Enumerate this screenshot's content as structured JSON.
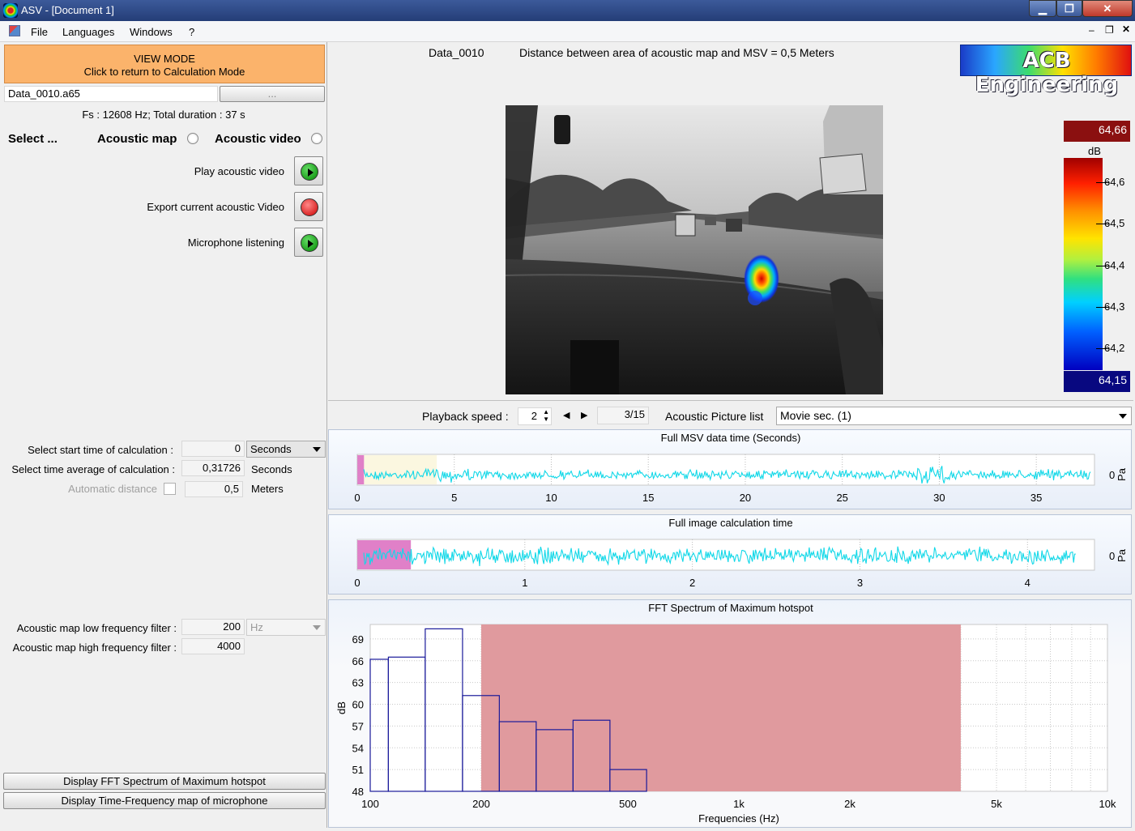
{
  "window": {
    "title": "ASV - [Document 1]"
  },
  "menu": [
    "File",
    "Languages",
    "Windows",
    "?"
  ],
  "mode_button": {
    "line1": "VIEW MODE",
    "line2": "Click to return to Calculation Mode"
  },
  "file": {
    "name": "Data_0010.a65",
    "browse": "...",
    "info": "Fs : 12608 Hz;  Total duration : 37 s"
  },
  "select": {
    "label": "Select ...",
    "option1": "Acoustic map",
    "option2": "Acoustic video"
  },
  "actions": [
    {
      "label": "Play acoustic video",
      "icon": "play-green-icon"
    },
    {
      "label": "Export current acoustic Video",
      "icon": "record-red-icon"
    },
    {
      "label": "Microphone listening",
      "icon": "play-green-icon"
    }
  ],
  "calc": {
    "start_label": "Select start time of calculation :",
    "start_value": "0",
    "start_unit": "Seconds",
    "avg_label": "Select time average of calculation :",
    "avg_value": "0,31726",
    "avg_unit": "Seconds",
    "dist_label": "Automatic distance",
    "dist_value": "0,5",
    "dist_unit": "Meters"
  },
  "filters": {
    "low_label": "Acoustic map low frequency filter :",
    "low_value": "200",
    "low_unit": "Hz",
    "high_label": "Acoustic map high frequency filter :",
    "high_value": "4000"
  },
  "bottom_buttons": {
    "fft": "Display FFT Spectrum of Maximum hotspot",
    "tf": "Display Time-Frequency map of microphone"
  },
  "header": {
    "dataset": "Data_0010",
    "distance_text": "Distance between area of acoustic map and MSV = 0,5 Meters",
    "logo": "ACB Engineering"
  },
  "colorbar": {
    "max": "64,66",
    "min": "64,15",
    "unit": "dB",
    "ticks": [
      "64,6",
      "64,5",
      "64,4",
      "64,3",
      "64,2"
    ]
  },
  "playback": {
    "label": "Playback speed :",
    "speed": "2",
    "frame": "3/15",
    "list_label": "Acoustic Picture list",
    "list_value": "Movie sec. (1)"
  },
  "chart_data": [
    {
      "type": "line",
      "title": "Full MSV data time  (Seconds)",
      "xticks": [
        "0",
        "5",
        "10",
        "15",
        "20",
        "25",
        "30",
        "35"
      ],
      "xlim": [
        0,
        38
      ],
      "ylabel": "Pa",
      "ytick": "0",
      "highlight_start": 0,
      "highlight_end": 0.35
    },
    {
      "type": "line",
      "title": "Full image calculation time",
      "xticks": [
        "0",
        "1",
        "2",
        "3",
        "4"
      ],
      "xlim": [
        0,
        4.4
      ],
      "ylabel": "Pa",
      "ytick": "0",
      "highlight_start": 0,
      "highlight_end": 0.32
    },
    {
      "type": "bar",
      "title": "FFT Spectrum of Maximum hotspot",
      "xlabel": "Frequencies (Hz)",
      "ylabel": "dB",
      "xscale": "log",
      "xlim": [
        100,
        10000
      ],
      "ylim": [
        48,
        71
      ],
      "yticks": [
        "48",
        "51",
        "54",
        "57",
        "60",
        "63",
        "66",
        "69"
      ],
      "xticks": [
        {
          "v": 100,
          "t": "100"
        },
        {
          "v": 200,
          "t": "200"
        },
        {
          "v": 500,
          "t": "500"
        },
        {
          "v": 1000,
          "t": "1k"
        },
        {
          "v": 2000,
          "t": "2k"
        },
        {
          "v": 5000,
          "t": "5k"
        },
        {
          "v": 10000,
          "t": "10k"
        }
      ],
      "band": [
        200,
        4000
      ],
      "bars": [
        {
          "from": 100,
          "to": 112,
          "value": 66.2
        },
        {
          "from": 112,
          "to": 141,
          "value": 66.5
        },
        {
          "from": 141,
          "to": 178,
          "value": 70.4
        },
        {
          "from": 178,
          "to": 224,
          "value": 61.2
        },
        {
          "from": 224,
          "to": 282,
          "value": 57.6
        },
        {
          "from": 282,
          "to": 355,
          "value": 56.5
        },
        {
          "from": 355,
          "to": 447,
          "value": 57.8
        },
        {
          "from": 447,
          "to": 562,
          "value": 51
        }
      ]
    }
  ]
}
